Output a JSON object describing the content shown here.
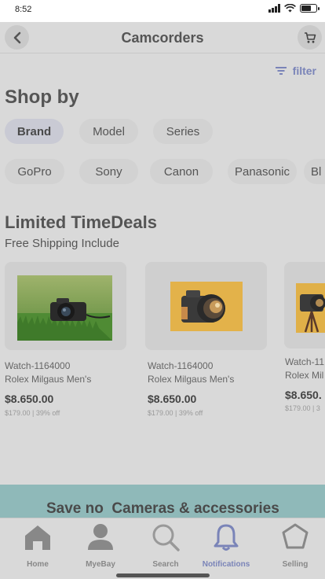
{
  "status": {
    "time": "8:52"
  },
  "header": {
    "title": "Camcorders",
    "back_icon": "back-arrow-icon",
    "cart_icon": "cart-icon"
  },
  "filter": {
    "label": "filter",
    "icon": "filter-lines-icon"
  },
  "shop_by": {
    "title": "Shop by",
    "tabs": [
      {
        "label": "Brand",
        "active": true
      },
      {
        "label": "Model",
        "active": false
      },
      {
        "label": "Series",
        "active": false
      }
    ],
    "brands": [
      "GoPro",
      "Sony",
      "Canon",
      "Panasonic",
      "Bl"
    ]
  },
  "deals": {
    "title": "Limited TimeDeals",
    "subtitle": "Free Shipping Include",
    "products": [
      {
        "sku": "Watch-1164000",
        "name": "Rolex Milgaus Men's",
        "price": "$8.650.00",
        "old": "$179.00 | 39% off"
      },
      {
        "sku": "Watch-1164000",
        "name": "Rolex Milgaus Men's",
        "price": "$8.650.00",
        "old": "$179.00 | 39% off"
      },
      {
        "sku": "Watch-11",
        "name": "Rolex Mil",
        "price": "$8.650.",
        "old": "$179.00 | 3"
      }
    ]
  },
  "banner": {
    "text": "Save no  Cameras & accessories"
  },
  "tabbar": {
    "items": [
      {
        "label": "Home",
        "icon": "home-icon"
      },
      {
        "label": "MyeBay",
        "icon": "user-icon"
      },
      {
        "label": "Search",
        "icon": "search-icon"
      },
      {
        "label": "Notifications",
        "icon": "bell-icon",
        "active": true
      },
      {
        "label": "Selling",
        "icon": "tag-icon"
      }
    ]
  },
  "colors": {
    "accent": "#7a84b8",
    "banner": "#8fb9b9",
    "background": "#d9d9d9"
  }
}
